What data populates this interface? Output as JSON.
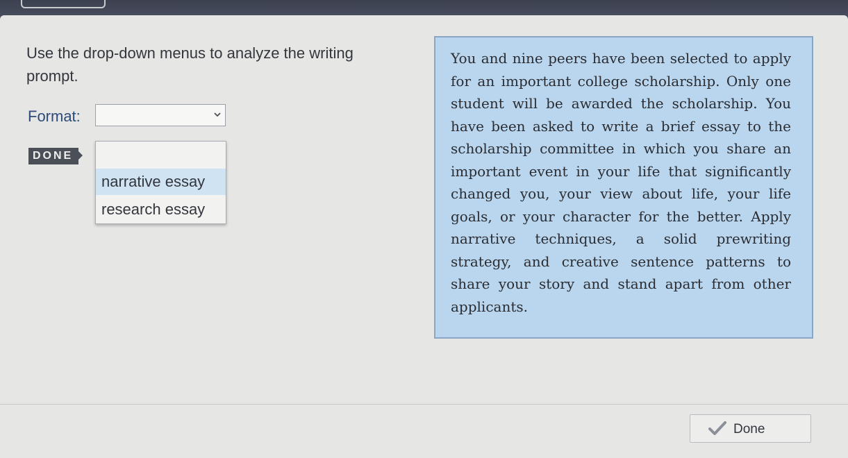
{
  "instruction": "Use the drop-down menus to analyze the writing prompt.",
  "format": {
    "label": "Format:",
    "selected_value": "",
    "options": [
      "narrative essay",
      "research essay"
    ]
  },
  "done_tag": "DONE",
  "prompt_text": "You and nine peers have been selected to apply for an important college scholarship. Only one student will be awarded the scholarship. You have been asked to write a brief essay to the scholarship committee in which you share an important event in your life that significantly changed you, your view about life, your life goals, or your character for the better. Apply narrative techniques, a solid prewriting strategy, and creative sentence patterns to share your story and stand apart from other applicants.",
  "done_button": {
    "label": "Done",
    "icon": "check-icon"
  },
  "colors": {
    "prompt_background": "#b9d6ee",
    "highlighted_option": "#cfe3f2",
    "format_label": "#2c4a7a",
    "done_tag_background": "#4b4f58"
  }
}
